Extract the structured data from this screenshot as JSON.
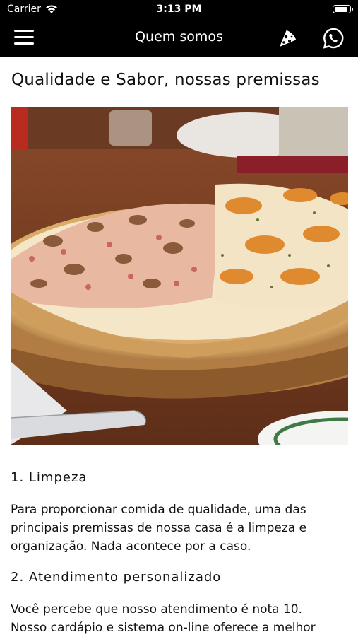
{
  "status_bar": {
    "carrier": "Carrier",
    "time": "3:13 PM",
    "battery_level": 0.9
  },
  "navbar": {
    "title": "Quem somos",
    "icons": [
      "menu-icon",
      "pizza-slice-icon",
      "whatsapp-icon"
    ]
  },
  "page": {
    "heading": "Qualidade e Sabor, nossas premissas",
    "photo_subject": "pizza-photo",
    "sections": [
      {
        "title": "1. Limpeza",
        "lines": [
          "Para proporcionar comida de qualidade, uma das",
          "principais premissas de nossa casa é a limpeza e",
          "organização. Nada acontece por a caso."
        ]
      },
      {
        "title": "2. Atendimento personalizado",
        "lines": [
          "Você percebe que nosso atendimento é nota 10.",
          "Nosso cardápio e sistema on-line oferece a melhor"
        ]
      }
    ]
  },
  "colors": {
    "bar_background": "#000000",
    "bar_foreground": "#ffffff",
    "text": "#111111"
  }
}
